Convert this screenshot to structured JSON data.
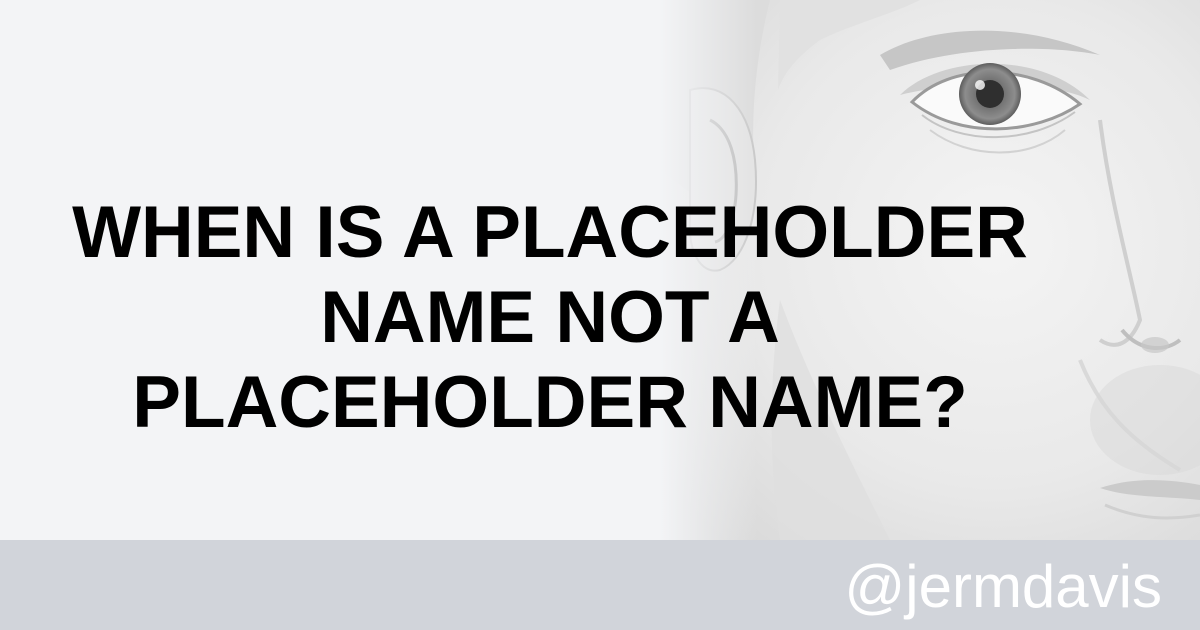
{
  "headline": {
    "line1": "WHEN IS A PLACEHOLDER",
    "line2": "NAME NOT A",
    "line3": "PLACEHOLDER NAME?"
  },
  "footer": {
    "handle": "@jermdavis"
  },
  "colors": {
    "background": "#f3f4f6",
    "footer_bar": "#d1d4da",
    "headline": "#000000",
    "handle": "#ffffff"
  },
  "icons": {
    "portrait": "face-portrait-image"
  }
}
